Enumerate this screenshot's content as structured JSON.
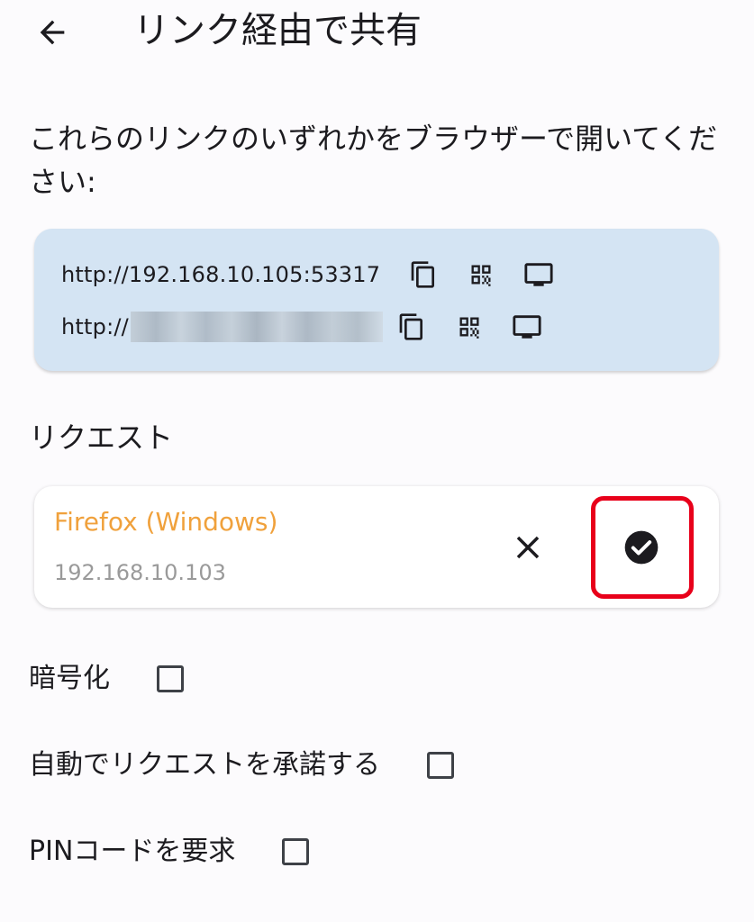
{
  "appbar": {
    "title": "リンク経由で共有",
    "back_icon": "arrow-back-icon"
  },
  "intro": "これらのリンクのいずれかをブラウザーで開いてください:",
  "links": [
    {
      "url": "http://192.168.10.105:53317",
      "redacted": false
    },
    {
      "url": "http://",
      "redacted": true
    }
  ],
  "link_icons": [
    "copy-icon",
    "qr-code-icon",
    "monitor-icon"
  ],
  "requests": {
    "label": "リクエスト",
    "items": [
      {
        "name": "Firefox (Windows)",
        "ip": "192.168.10.103"
      }
    ]
  },
  "options": {
    "encryption": {
      "label": "暗号化",
      "checked": false
    },
    "auto_accept": {
      "label": "自動でリクエストを承諾する",
      "checked": false
    },
    "require_pin": {
      "label": "PINコードを要求",
      "checked": false
    }
  },
  "colors": {
    "background": "#fcfbfd",
    "links_card": "#d4e4f3",
    "request_name": "#f0a13c",
    "request_ip": "#9a9a9a",
    "highlight": "#e8001a"
  }
}
